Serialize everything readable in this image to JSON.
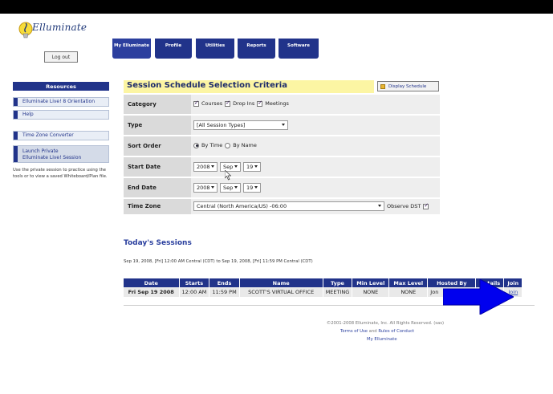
{
  "header": {
    "logo_text": "Elluminate",
    "logout_label": "Log out",
    "tabs": [
      {
        "label": "My Elluminate"
      },
      {
        "label": "Profile"
      },
      {
        "label": "Utilities"
      },
      {
        "label": "Reports"
      },
      {
        "label": "Software"
      }
    ]
  },
  "sidebar": {
    "heading": "Resources",
    "items": [
      {
        "label": "Elluminate Live! 8 Orientation"
      },
      {
        "label": "Help"
      },
      {
        "label": "Time Zone Converter"
      },
      {
        "label_line1": "Launch Private",
        "label_line2": "Elluminate Live! Session"
      }
    ],
    "note": "Use the private session to practice using the tools or to view a saved Whiteboard/Plan file."
  },
  "criteria": {
    "title": "Session Schedule Selection Criteria",
    "display_button": "Display Schedule",
    "category_label": "Category",
    "category_options": [
      "Courses",
      "Drop Ins",
      "Meetings"
    ],
    "type_label": "Type",
    "type_value": "[All Session Types]",
    "sort_label": "Sort Order",
    "sort_options": [
      "By Time",
      "By Name"
    ],
    "sort_selected": "By Time",
    "start_label": "Start Date",
    "start": {
      "year": "2008",
      "month": "Sep",
      "day": "19"
    },
    "end_label": "End Date",
    "end": {
      "year": "2008",
      "month": "Sep",
      "day": "19"
    },
    "tz_label": "Time Zone",
    "tz_value": "Central (North America/US) -06:00",
    "dst_label": "Observe DST"
  },
  "today": {
    "title": "Today's Sessions",
    "range": "Sep 19, 2008, [Fri] 12:00 AM Central (CDT) to Sep 19, 2008, [Fri] 11:59 PM Central (CDT)",
    "columns": [
      "Date",
      "Starts",
      "Ends",
      "Name",
      "Type",
      "Min Level",
      "Max Level",
      "Hosted By",
      "Details",
      "Join"
    ],
    "rows": [
      {
        "date": "Fri Sep 19 2008",
        "starts": "12:00 AM",
        "ends": "11:59 PM",
        "name": "SCOTT'S VIRTUAL OFFICE",
        "type": "MEETING",
        "min": "NONE",
        "max": "NONE",
        "host": "Jon",
        "details": "",
        "join": "Join"
      }
    ]
  },
  "footer": {
    "copyright": "©2001-2008 Elluminate, Inc. All Rights Reserved. (sas)",
    "terms": "Terms of Use",
    "and": "and",
    "rules": "Rules of Conduct",
    "my": "My Elluminate"
  },
  "colors": {
    "brand_blue": "#21338a",
    "highlight_yellow": "#fcf5a3",
    "arrow_blue": "#0000ee"
  }
}
